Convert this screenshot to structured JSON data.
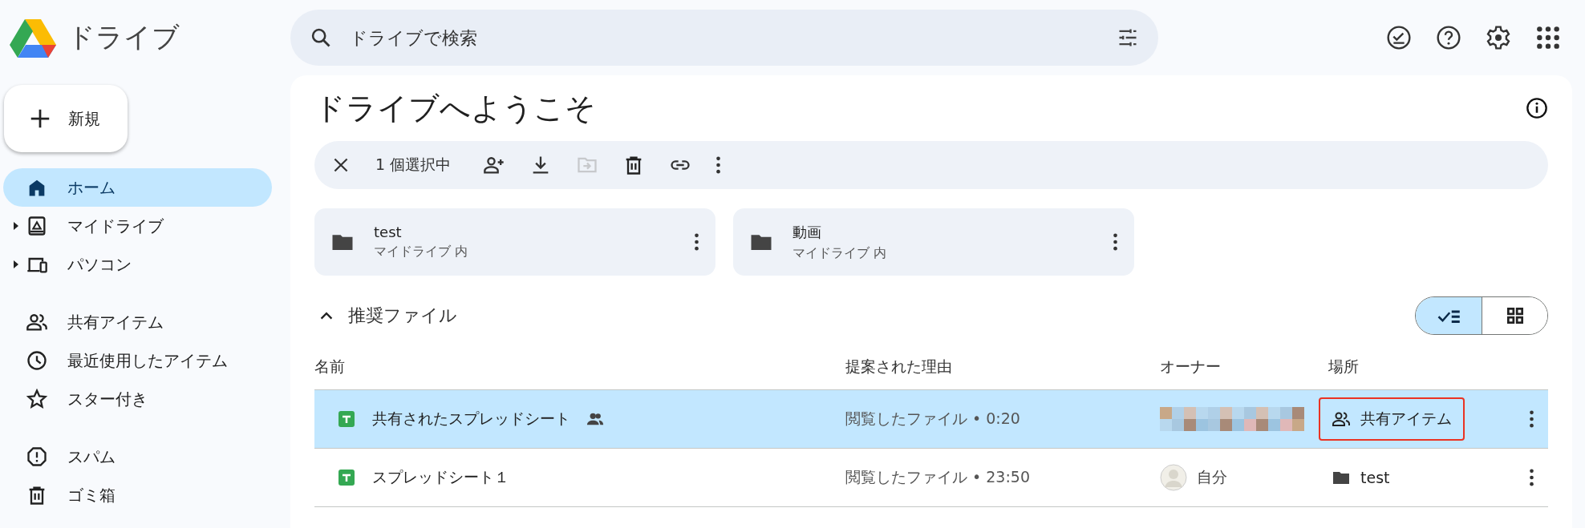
{
  "app": {
    "title": "ドライブ"
  },
  "search": {
    "placeholder": "ドライブで検索"
  },
  "new_button": {
    "label": "新規"
  },
  "sidebar": {
    "items": [
      {
        "label": "ホーム",
        "selected": true,
        "expandable": false
      },
      {
        "label": "マイドライブ",
        "selected": false,
        "expandable": true
      },
      {
        "label": "パソコン",
        "selected": false,
        "expandable": true
      },
      {
        "label": "共有アイテム",
        "selected": false,
        "expandable": false
      },
      {
        "label": "最近使用したアイテム",
        "selected": false,
        "expandable": false
      },
      {
        "label": "スター付き",
        "selected": false,
        "expandable": false
      },
      {
        "label": "スパム",
        "selected": false,
        "expandable": false
      },
      {
        "label": "ゴミ箱",
        "selected": false,
        "expandable": false
      }
    ]
  },
  "main": {
    "title": "ドライブへようこそ"
  },
  "selection_bar": {
    "count": "1 個選択中",
    "actions": [
      {
        "disabled": false
      },
      {
        "disabled": false
      },
      {
        "disabled": true
      },
      {
        "disabled": false
      },
      {
        "disabled": false
      },
      {
        "disabled": false
      }
    ]
  },
  "folders": [
    {
      "name": "test",
      "location": "マイドライブ 内"
    },
    {
      "name": "動画",
      "location": "マイドライブ 内"
    }
  ],
  "section": {
    "title": "推奨ファイル",
    "expanded": true
  },
  "view_toggle": [
    {
      "selected": true
    },
    {
      "selected": false
    }
  ],
  "table": {
    "columns": [
      "名前",
      "提案された理由",
      "オーナー",
      "場所"
    ],
    "rows": [
      {
        "name": "共有されたスプレッドシート",
        "shared": true,
        "reason": "閲覧したファイル • 0:20",
        "owner": {
          "kind": "redacted"
        },
        "location": {
          "kind": "shared",
          "label": "共有アイテム",
          "highlighted": true
        },
        "selected": true
      },
      {
        "name": "スプレッドシート１",
        "shared": false,
        "reason": "閲覧したファイル • 23:50",
        "owner": {
          "kind": "user",
          "name": "自分"
        },
        "location": {
          "kind": "folder",
          "label": "test",
          "highlighted": false
        },
        "selected": false
      }
    ]
  }
}
